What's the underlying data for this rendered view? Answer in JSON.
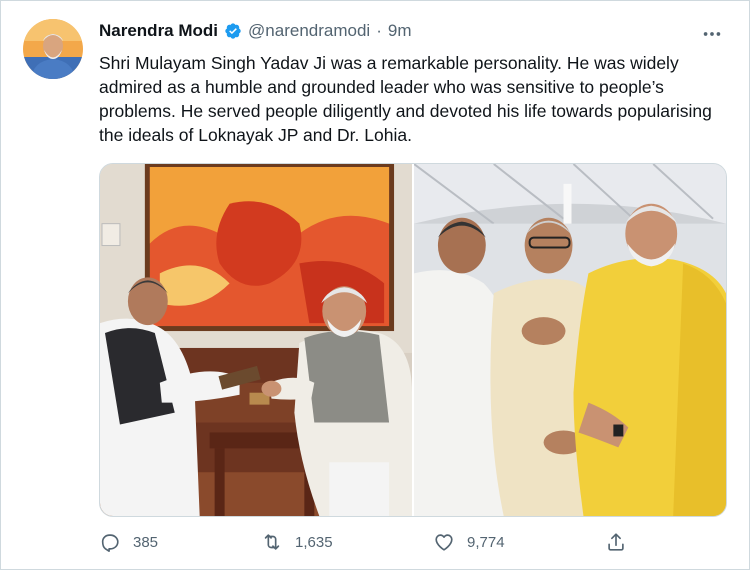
{
  "tweet": {
    "author_name": "Narendra Modi",
    "handle": "@narendramodi",
    "separator": "·",
    "time": "9m",
    "text": "Shri Mulayam Singh Yadav Ji was a remarkable personality. He was widely admired as a humble and grounded leader who was sensitive to people’s problems. He served people diligently and devoted his life towards popularising the ideals of Loknayak JP and Dr. Lohia.",
    "verified": true,
    "more_icon": "more-horizontal-icon"
  },
  "media": {
    "count": 2,
    "photos": [
      {
        "subject": "two leaders seated, one holding a book, in front of an orange painting"
      },
      {
        "subject": "three leaders standing and shaking hands under a tent"
      }
    ]
  },
  "actions": {
    "reply_count": "385",
    "retweet_count": "1,635",
    "like_count": "9,774",
    "icons": [
      "reply-icon",
      "retweet-icon",
      "like-icon",
      "share-icon"
    ]
  },
  "colors": {
    "verified": "#1d9bf0",
    "text_primary": "#0f1419",
    "text_secondary": "#536471",
    "border": "#cfd9de"
  }
}
